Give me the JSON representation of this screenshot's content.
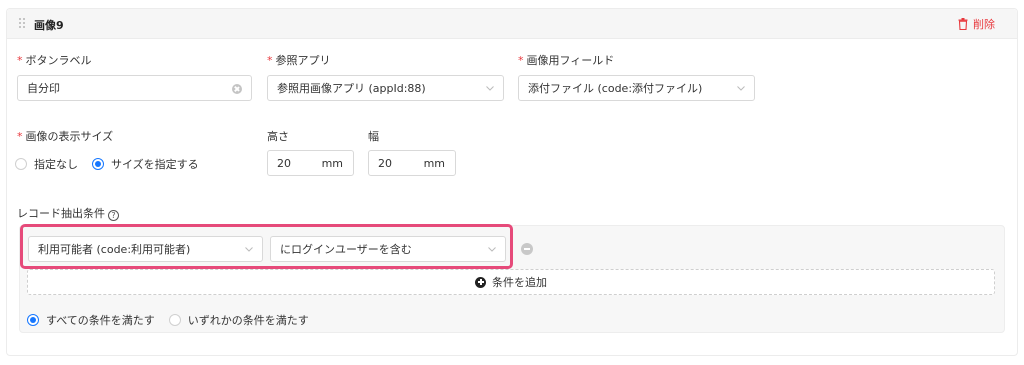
{
  "card": {
    "title": "画像9",
    "delete_label": "削除"
  },
  "button_label": {
    "label": "ボタンラベル",
    "value": "自分印"
  },
  "ref_app": {
    "label": "参照アプリ",
    "value": "参照用画像アプリ (appId:88)"
  },
  "image_field": {
    "label": "画像用フィールド",
    "value": "添付ファイル (code:添付ファイル)"
  },
  "display_size": {
    "label": "画像の表示サイズ",
    "options": [
      "指定なし",
      "サイズを指定する"
    ],
    "selected": "サイズを指定する"
  },
  "height": {
    "label": "高さ",
    "value": "20",
    "unit": "mm"
  },
  "width": {
    "label": "幅",
    "value": "20",
    "unit": "mm"
  },
  "conditions": {
    "label": "レコード抽出条件",
    "help_glyph": "?",
    "field_value": "利用可能者 (code:利用可能者)",
    "operator_value": "にログインユーザーを含む",
    "add_label": "条件を追加",
    "match_options": [
      "すべての条件を満たす",
      "いずれかの条件を満たす"
    ],
    "match_selected": "すべての条件を満たす"
  },
  "colors": {
    "accent": "#1677ff",
    "danger": "#e8383d",
    "highlight": "#e64a7a"
  }
}
